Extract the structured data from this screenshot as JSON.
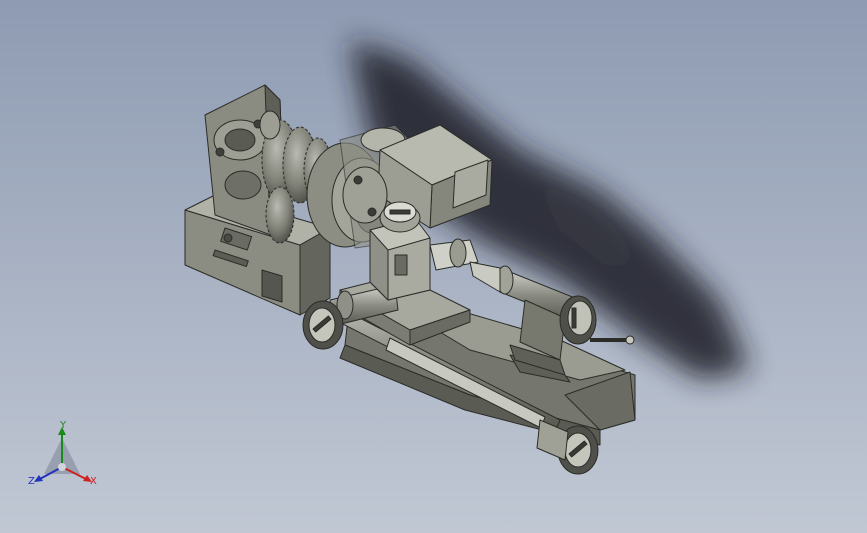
{
  "view": {
    "background_top": "#8e9bb2",
    "background_bottom": "#c1c8d4",
    "model_color": "#85877d",
    "shadow_color": "#1c1f26"
  },
  "triad": {
    "x_label": "X",
    "y_label": "Y",
    "z_label": "Z",
    "x_color": "#cc2222",
    "y_color": "#1a8a1a",
    "z_color": "#2233bb"
  }
}
